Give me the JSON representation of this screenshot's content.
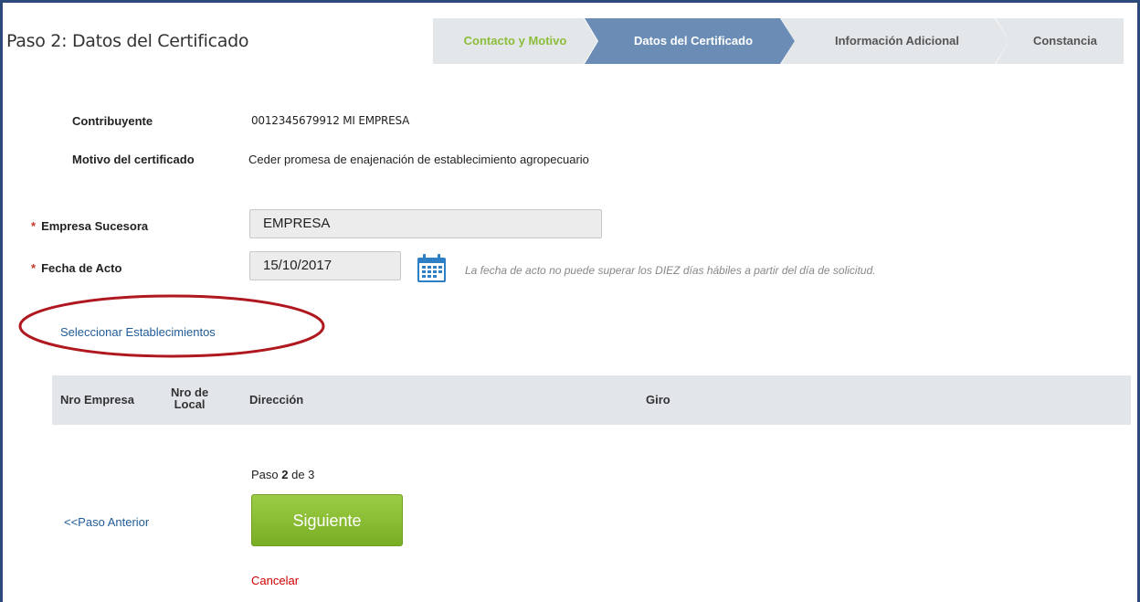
{
  "page_title": "Paso 2: Datos del Certificado",
  "stepper": {
    "steps": [
      {
        "label": "Contacto y Motivo",
        "state": "done"
      },
      {
        "label": "Datos del Certificado",
        "state": "active"
      },
      {
        "label": "Información Adicional",
        "state": "pending"
      },
      {
        "label": "Constancia",
        "state": "pending"
      }
    ]
  },
  "info": {
    "contribuyente_label": "Contribuyente",
    "contribuyente_value": "0012345679912 MI EMPRESA",
    "motivo_label": "Motivo del certificado",
    "motivo_value": "Ceder promesa de enajenación de establecimiento agropecuario"
  },
  "form": {
    "empresa_label": "Empresa Sucesora",
    "empresa_value": "EMPRESA",
    "fecha_label": "Fecha de Acto",
    "fecha_value": "15/10/2017",
    "required_mark": "*",
    "fecha_hint": "La fecha de acto no puede superar los DIEZ días hábiles a partir del día de solicitud."
  },
  "select_link": "Seleccionar Establecimientos",
  "table": {
    "col_nro_empresa": "Nro Empresa",
    "col_nro_local_1": "Nro de",
    "col_nro_local_2": "Local",
    "col_direccion": "Dirección",
    "col_giro": "Giro"
  },
  "pager": {
    "prefix": "Paso ",
    "current": "2",
    "suffix": " de 3"
  },
  "nav": {
    "prev_link": "<<Paso Anterior",
    "next_button": "Siguiente",
    "cancel_link": "Cancelar"
  },
  "colors": {
    "step_done_text": "#8cbd3a",
    "step_active_bg": "#6b8db5",
    "step_pending_bg": "#e4e7ea",
    "highlight_ellipse": "#b0181f",
    "next_button": "#8bbf34"
  },
  "icons": {
    "calendar": "calendar-icon"
  }
}
